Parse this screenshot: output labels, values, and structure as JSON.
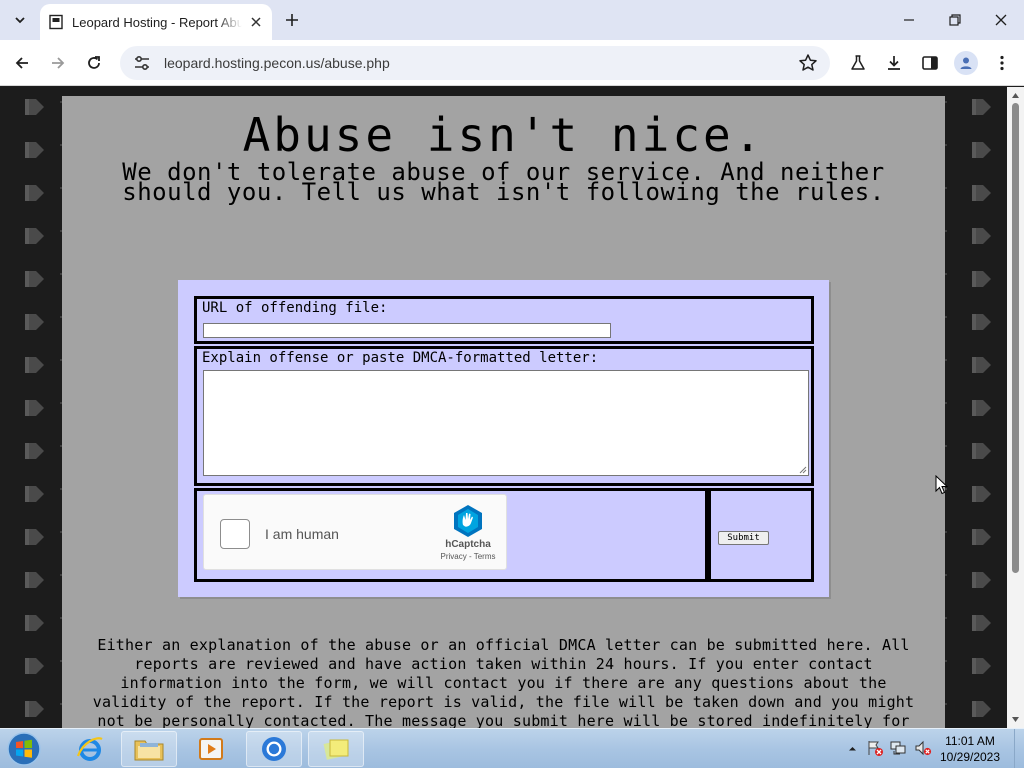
{
  "browser": {
    "tab_title": "Leopard Hosting - Report Abuse",
    "url": "leopard.hosting.pecon.us/abuse.php"
  },
  "page": {
    "headline": "Abuse isn't nice.",
    "subhead": "We don't tolerate abuse of our service. And neither should you. Tell us what isn't following the rules.",
    "form": {
      "url_label": "URL of offending file:",
      "url_value": "",
      "message_label": "Explain offense or paste DMCA-formatted letter:",
      "message_value": "",
      "captcha_label": "I am human",
      "captcha_brand": "hCaptcha",
      "captcha_links": "Privacy - Terms",
      "submit_label": "Submit"
    },
    "body_text": "Either an explanation of the abuse or an official DMCA letter can be submitted here. All reports are reviewed and have action taken within 24 hours. If you enter contact information into the form, we will contact you if there are any questions about the validity of the report. If the report is valid, the file will be taken down and you might not be personally contacted. The message you submit here will be stored indefinitely for record purposes, but"
  },
  "taskbar": {
    "time": "11:01 AM",
    "date": "10/29/2023"
  },
  "colors": {
    "page_bg": "#a3a3a3",
    "form_bg": "#cccbff",
    "outer_bg": "#1c1c1c",
    "hcaptcha_teal": "#0074bf"
  }
}
